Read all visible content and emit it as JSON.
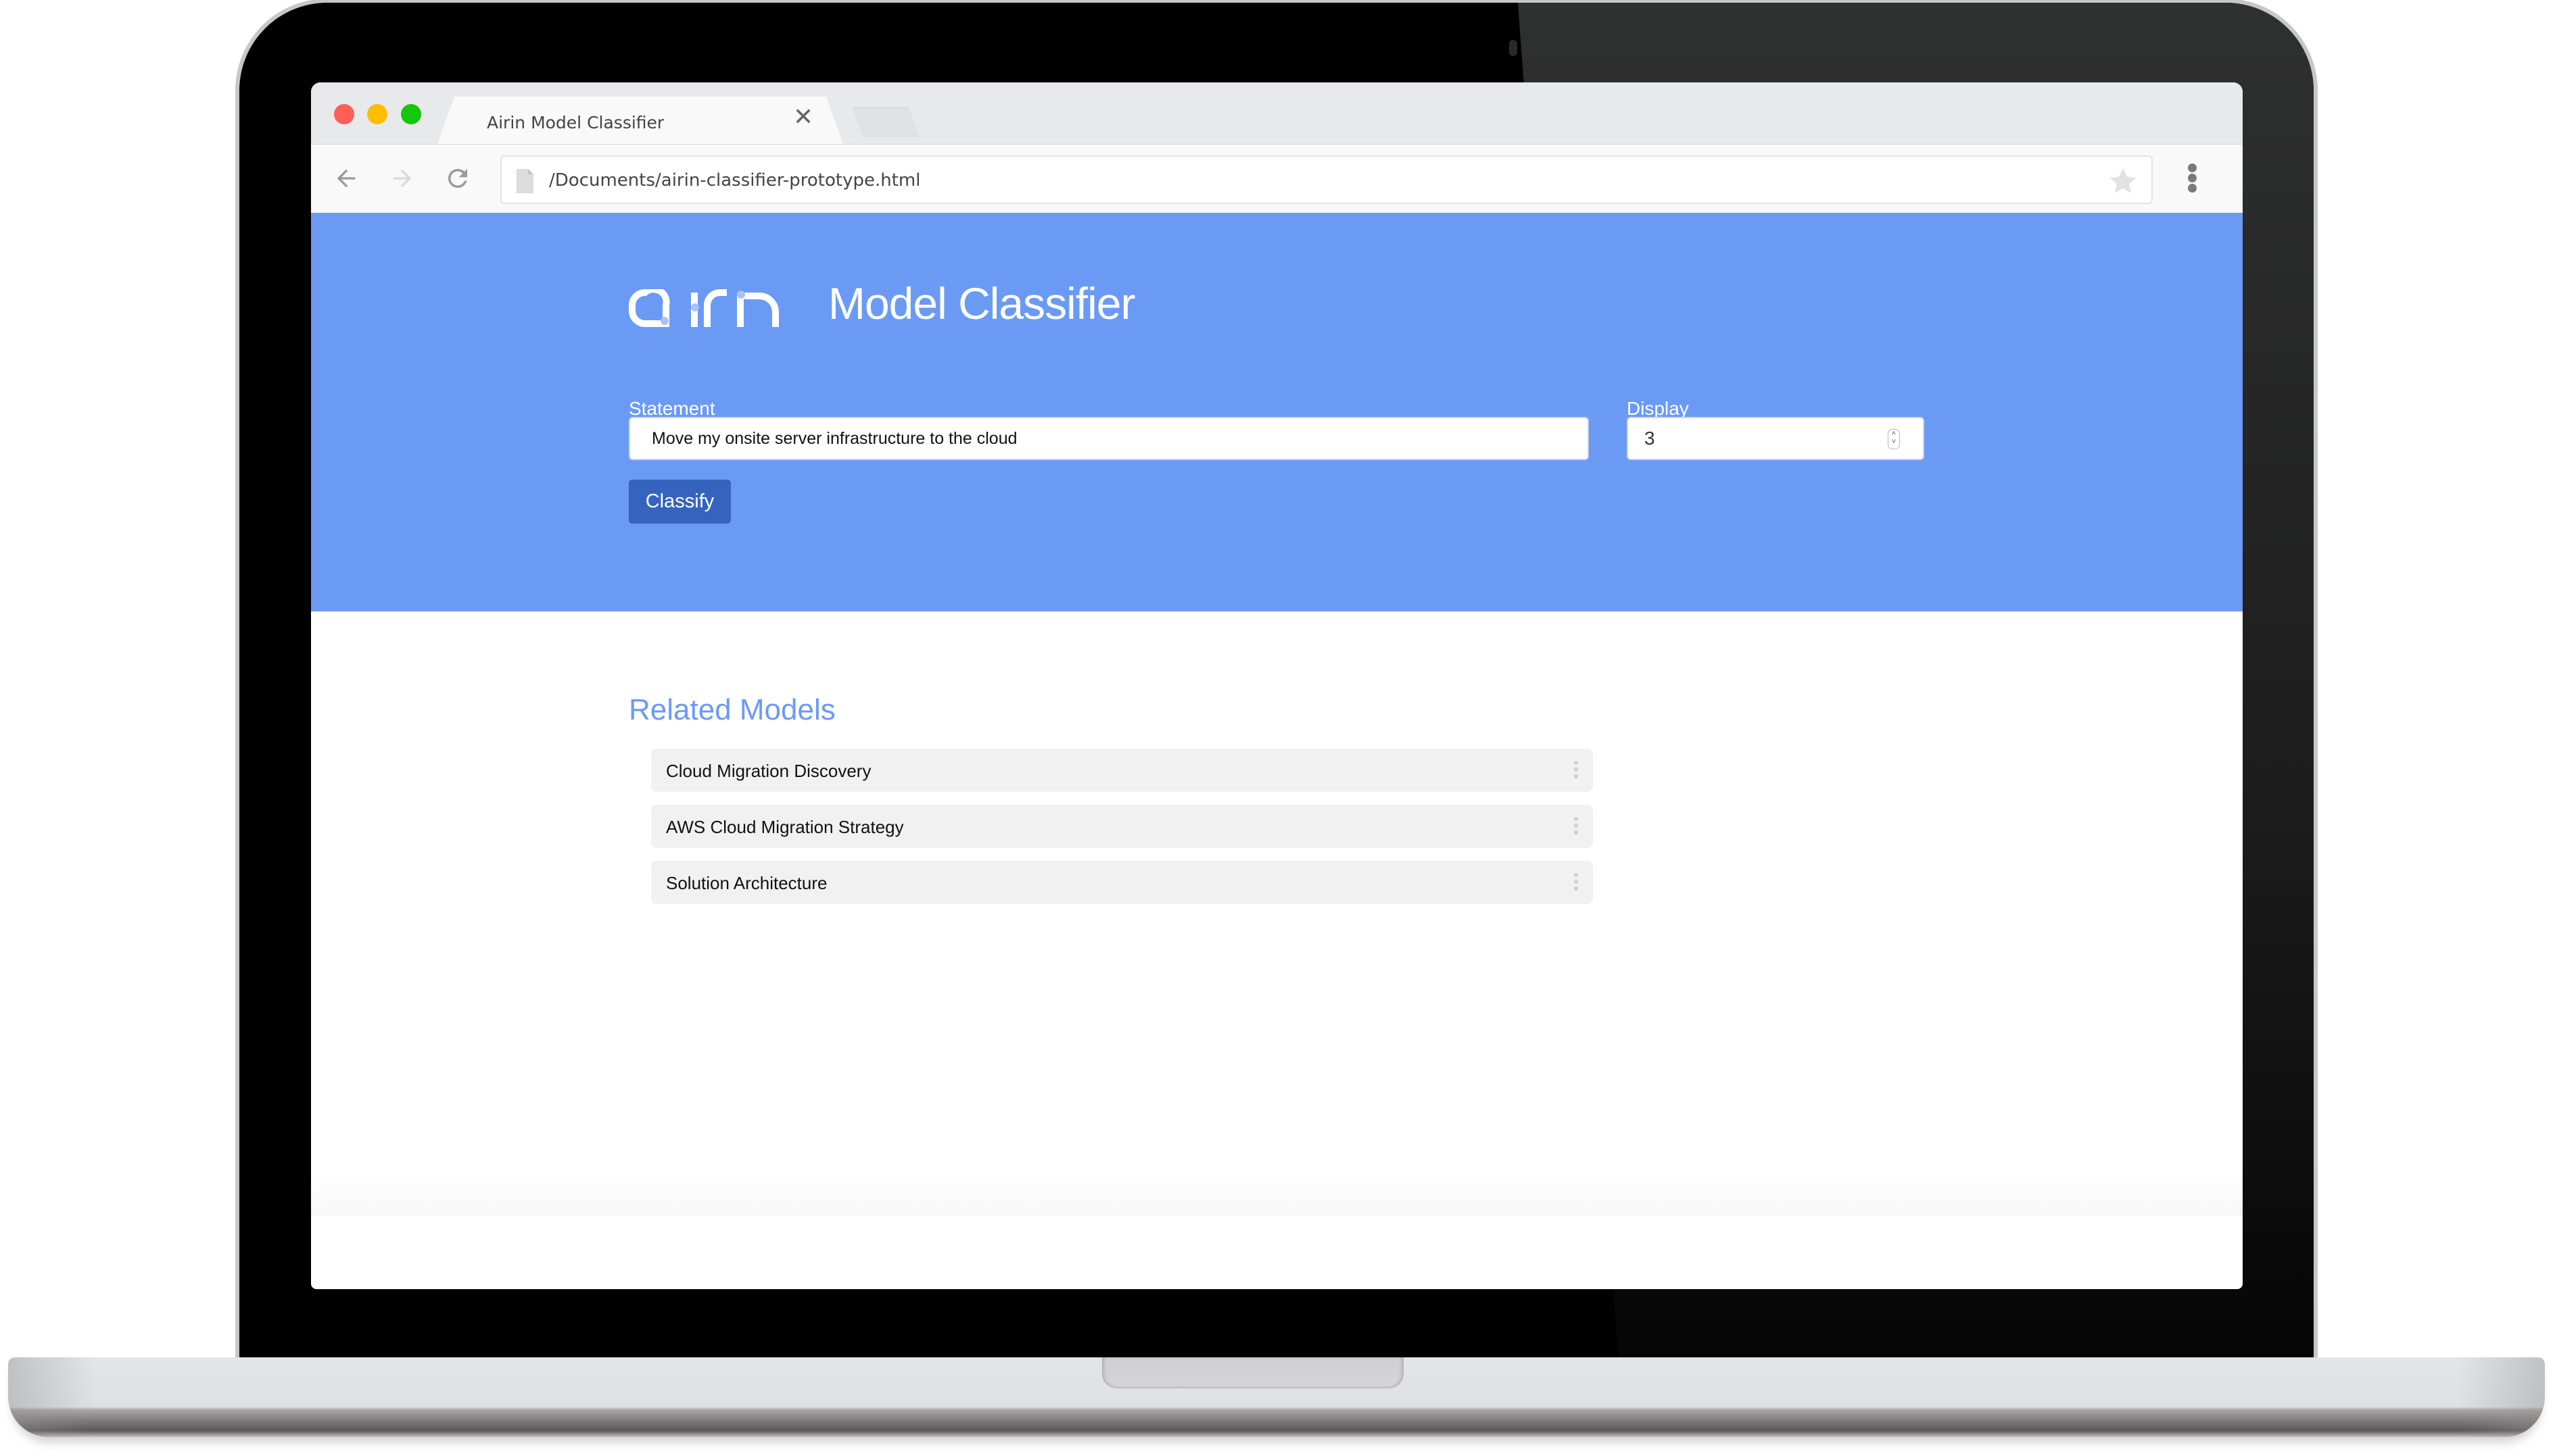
{
  "browser": {
    "tab_title": "Airin Model Classifier",
    "tab_close_glyph": "✕",
    "address_url": "/Documents/airin-classifier-prototype.html",
    "icons": [
      "back-arrow-icon",
      "forward-arrow-icon",
      "reload-icon",
      "document-icon",
      "star-icon",
      "menu-kebab-icon"
    ]
  },
  "header": {
    "logo_text": "airin",
    "title": "Model Classifier"
  },
  "form": {
    "statement_label": "Statement",
    "statement_value": "Move my onsite server infrastructure to the cloud",
    "display_label": "Display",
    "display_value": "3",
    "classify_button": "Classify"
  },
  "results": {
    "heading": "Related Models",
    "items": [
      {
        "label": "Cloud Migration Discovery"
      },
      {
        "label": "AWS Cloud Migration Strategy"
      },
      {
        "label": "Solution Architecture"
      }
    ]
  },
  "colors": {
    "brand_blue": "#6b9af5",
    "button_blue": "#3663be",
    "list_item_bg": "#f1f1f1"
  }
}
